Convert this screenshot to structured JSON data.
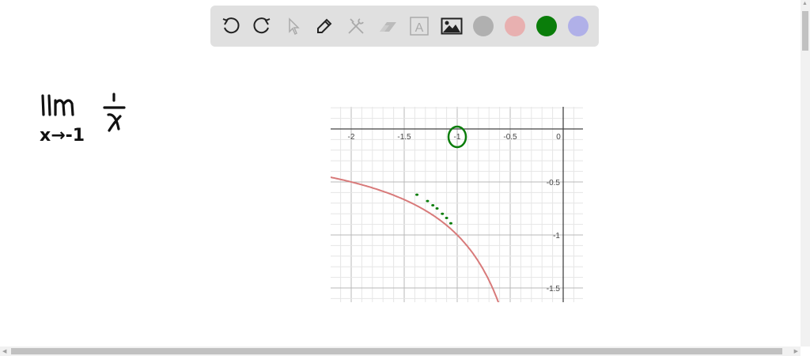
{
  "toolbar": {
    "tools": [
      "undo-icon",
      "redo-icon",
      "select-pointer-icon",
      "pen-icon",
      "tools-icon",
      "eraser-icon",
      "text-icon",
      "image-icon"
    ],
    "text_tool_glyph": "A",
    "colors": [
      "#b0b0b0",
      "#e8b0b0",
      "#0a7d0a",
      "#b0b0e8"
    ]
  },
  "note": {
    "lim": "lim",
    "approach": "x→-1",
    "numerator": "1",
    "denominator": "x"
  },
  "chart_data": {
    "type": "line",
    "function": "y = 1/x",
    "x_range": [
      -2.2,
      0.18
    ],
    "y_range": [
      -1.62,
      0.2
    ],
    "x_ticks": [
      -2,
      -1.5,
      -1,
      -0.5,
      0
    ],
    "x_tick_labels": [
      "-2",
      "-1.5",
      "-1",
      "-0.5",
      "0"
    ],
    "y_ticks": [
      -0.5,
      -1,
      -1.5
    ],
    "y_tick_labels": [
      "-0.5",
      "-1",
      "-1.5"
    ],
    "grid": true,
    "minor_step": 0.1,
    "curve_color": "#d87a7a",
    "annotation_color": "#0a7d0a",
    "annotation": "circle around x = -1 tick label; dotted path approaching (-1,-1) from the left"
  }
}
